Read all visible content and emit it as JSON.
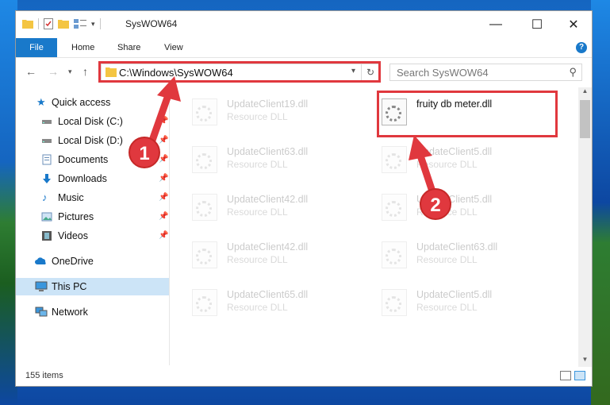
{
  "window": {
    "title": "SysWOW64",
    "controls": {
      "minimize": "—",
      "maximize": "☐",
      "close": "✕"
    }
  },
  "ribbon": {
    "tabs": [
      "File",
      "Home",
      "Share",
      "View"
    ],
    "help": "?"
  },
  "address": {
    "path": "C:\\Windows\\SysWOW64",
    "search_placeholder": "Search SysWOW64"
  },
  "sidebar": {
    "items": [
      {
        "label": "Quick access",
        "icon": "star-icon"
      },
      {
        "label": "Local Disk (C:)",
        "icon": "drive-icon",
        "pinned": true
      },
      {
        "label": "Local Disk (D:)",
        "icon": "drive-icon",
        "pinned": true
      },
      {
        "label": "Documents",
        "icon": "documents-icon",
        "pinned": true
      },
      {
        "label": "Downloads",
        "icon": "downloads-icon",
        "pinned": true
      },
      {
        "label": "Music",
        "icon": "music-icon",
        "pinned": true
      },
      {
        "label": "Pictures",
        "icon": "pictures-icon",
        "pinned": true
      },
      {
        "label": "Videos",
        "icon": "videos-icon",
        "pinned": true
      },
      {
        "label": "OneDrive",
        "icon": "cloud-icon"
      },
      {
        "label": "This PC",
        "icon": "computer-icon",
        "selected": true
      },
      {
        "label": "Network",
        "icon": "network-icon"
      }
    ]
  },
  "files": [
    {
      "name": "UpdateClient19.dll",
      "type": "Resource DLL"
    },
    {
      "name": "fruity db meter.dll",
      "type": "",
      "highlight": true
    },
    {
      "name": "UpdateClient63.dll",
      "type": "Resource DLL"
    },
    {
      "name": "UpdateClient5.dll",
      "type": "Resource DLL"
    },
    {
      "name": "UpdateClient42.dll",
      "type": "Resource DLL"
    },
    {
      "name": "UpdateClient5.dll",
      "type": "Resource DLL"
    },
    {
      "name": "UpdateClient42.dll",
      "type": "Resource DLL"
    },
    {
      "name": "UpdateClient63.dll",
      "type": "Resource DLL"
    },
    {
      "name": "UpdateClient65.dll",
      "type": "Resource DLL"
    },
    {
      "name": "UpdateClient5.dll",
      "type": "Resource DLL"
    }
  ],
  "status": {
    "count": "155 items"
  },
  "annotations": {
    "step1": "1",
    "step2": "2",
    "color": "#e0383e"
  }
}
